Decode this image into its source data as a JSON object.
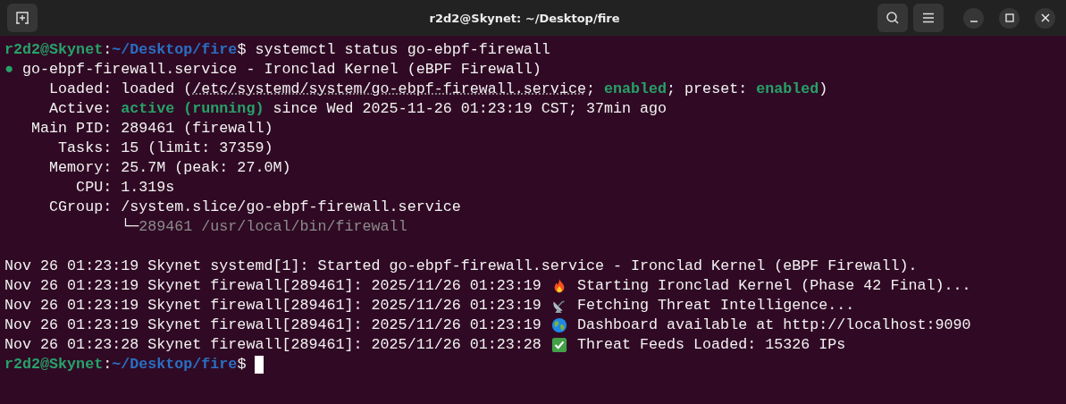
{
  "window": {
    "title": "r2d2@Skynet: ~/Desktop/fire"
  },
  "command_line": [
    {
      "text": "r2d2@Skynet",
      "kind": "user"
    },
    {
      "text": ":",
      "kind": "plain"
    },
    {
      "text": "~/Desktop/fire",
      "kind": "path"
    },
    {
      "text": "$ systemctl status go-ebpf-firewall",
      "kind": "plain"
    }
  ],
  "status_lines": [
    [
      {
        "text": "●",
        "kind": "dot"
      },
      {
        "text": " go-ebpf-firewall.service - Ironclad Kernel (eBPF Firewall)",
        "kind": "plain"
      }
    ],
    [
      {
        "text": "     Loaded: loaded (",
        "kind": "plain"
      },
      {
        "text": "/etc/systemd/system/go-ebpf-firewall.service",
        "kind": "link"
      },
      {
        "text": "; ",
        "kind": "plain"
      },
      {
        "text": "enabled",
        "kind": "ok"
      },
      {
        "text": "; preset: ",
        "kind": "plain"
      },
      {
        "text": "enabled",
        "kind": "ok"
      },
      {
        "text": ")",
        "kind": "plain"
      }
    ],
    [
      {
        "text": "     Active: ",
        "kind": "plain"
      },
      {
        "text": "active (running)",
        "kind": "ok"
      },
      {
        "text": " since Wed 2025-11-26 01:23:19 CST; 37min ago",
        "kind": "plain"
      }
    ],
    [
      {
        "text": "   Main PID: 289461 (firewall)",
        "kind": "plain"
      }
    ],
    [
      {
        "text": "      Tasks: 15 (limit: 37359)",
        "kind": "plain"
      }
    ],
    [
      {
        "text": "     Memory: 25.7M (peak: 27.0M)",
        "kind": "plain"
      }
    ],
    [
      {
        "text": "        CPU: 1.319s",
        "kind": "plain"
      }
    ],
    [
      {
        "text": "     CGroup: /system.slice/go-ebpf-firewall.service",
        "kind": "plain"
      }
    ],
    [
      {
        "text": "             └─",
        "kind": "plain"
      },
      {
        "text": "289461 /usr/local/bin/firewall",
        "kind": "dim"
      }
    ]
  ],
  "log_lines": [
    [
      {
        "text": "Nov 26 01:23:19 Skynet systemd[1]: Started go-ebpf-firewall.service - Ironclad Kernel (eBPF Firewall).",
        "kind": "plain"
      }
    ],
    [
      {
        "text": "Nov 26 01:23:19 Skynet firewall[289461]: 2025/11/26 01:23:19 ",
        "kind": "plain"
      },
      {
        "kind": "fire"
      },
      {
        "text": " Starting Ironclad Kernel (Phase 42 Final)...",
        "kind": "plain"
      }
    ],
    [
      {
        "text": "Nov 26 01:23:19 Skynet firewall[289461]: 2025/11/26 01:23:19 ",
        "kind": "plain"
      },
      {
        "kind": "antenna"
      },
      {
        "text": " Fetching Threat Intelligence...",
        "kind": "plain"
      }
    ],
    [
      {
        "text": "Nov 26 01:23:19 Skynet firewall[289461]: 2025/11/26 01:23:19 ",
        "kind": "plain"
      },
      {
        "kind": "globe"
      },
      {
        "text": " Dashboard available at http://localhost:9090",
        "kind": "plain"
      }
    ],
    [
      {
        "text": "Nov 26 01:23:28 Skynet firewall[289461]: 2025/11/26 01:23:28 ",
        "kind": "plain"
      },
      {
        "kind": "check"
      },
      {
        "text": " Threat Feeds Loaded: 15326 IPs",
        "kind": "plain"
      }
    ]
  ],
  "prompt_line": [
    {
      "text": "r2d2@Skynet",
      "kind": "user"
    },
    {
      "text": ":",
      "kind": "plain"
    },
    {
      "text": "~/Desktop/fire",
      "kind": "path"
    },
    {
      "text": "$ ",
      "kind": "plain"
    }
  ]
}
